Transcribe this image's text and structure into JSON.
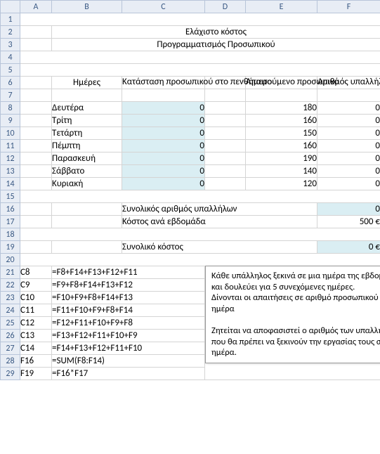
{
  "columns": [
    "A",
    "B",
    "C",
    "D",
    "E",
    "F"
  ],
  "rows": [
    "1",
    "2",
    "3",
    "4",
    "5",
    "6",
    "7",
    "8",
    "9",
    "10",
    "11",
    "12",
    "13",
    "14",
    "15",
    "16",
    "17",
    "18",
    "19",
    "20",
    "21",
    "22",
    "23",
    "24",
    "25",
    "26",
    "27",
    "28",
    "29"
  ],
  "titles": {
    "line1": "Ελάχιστο κόστος",
    "line2": "Προγραμματισμός Προσωπικού"
  },
  "headers": {
    "days": "Ημέρες",
    "status": "Κατάσταση προσωπικού στο πενθήμερο",
    "required": "Απαιτούμενο προσωπικό",
    "count": "Αριθμός υπαλλήλων ανά ημέρα"
  },
  "days": [
    {
      "name": "Δευτέρα",
      "status": "0",
      "required": "180",
      "count": "0"
    },
    {
      "name": "Τρίτη",
      "status": "0",
      "required": "160",
      "count": "0"
    },
    {
      "name": "Τετάρτη",
      "status": "0",
      "required": "150",
      "count": "0"
    },
    {
      "name": "Πέμπτη",
      "status": "0",
      "required": "160",
      "count": "0"
    },
    {
      "name": "Παρασκευή",
      "status": "0",
      "required": "190",
      "count": "0"
    },
    {
      "name": "Σάββατο",
      "status": "0",
      "required": "140",
      "count": "0"
    },
    {
      "name": "Κυριακή",
      "status": "0",
      "required": "120",
      "count": "0"
    }
  ],
  "summary": {
    "total_emp_label": "Συνολικός αριθμός υπαλλήλων",
    "total_emp_value": "0",
    "weekly_cost_label": "Κόστος ανά εβδομάδα",
    "weekly_cost_value": "500 €",
    "total_cost_label": "Συνολικό κόστος",
    "total_cost_value": "0 €"
  },
  "formulas": [
    {
      "ref": "C8",
      "formula": "=F8+F14+F13+F12+F11"
    },
    {
      "ref": "C9",
      "formula": "=F9+F8+F14+F13+F12"
    },
    {
      "ref": "C10",
      "formula": "=F10+F9+F8+F14+F13"
    },
    {
      "ref": "C11",
      "formula": "=F11+F10+F9+F8+F14"
    },
    {
      "ref": "C12",
      "formula": "=F12+F11+F10+F9+F8"
    },
    {
      "ref": "C13",
      "formula": "=F13+F12+F11+F10+F9"
    },
    {
      "ref": "C14",
      "formula": "=F14+F13+F12+F11+F10"
    },
    {
      "ref": "F16",
      "formula": "=SUM(F8:F14)"
    },
    {
      "ref": "F19",
      "formula": "=F16*F17"
    }
  ],
  "note": {
    "p1": "Κάθε υπάλληλος ξεκινά σε μια ημέρα της εβδομάδας και δουλεύει για 5 συνεχόμενες ημέρες.",
    "p2": "Δίνονται οι απαιτήσεις σε αριθμό προσωπικού ανά ημέρα",
    "p3": "Ζητείται να αποφασιστεί ο αριθμός των υπαλλήλων που θα πρέπει να ξεκινούν την εργασίας τους σε κάθε ημέρα."
  }
}
